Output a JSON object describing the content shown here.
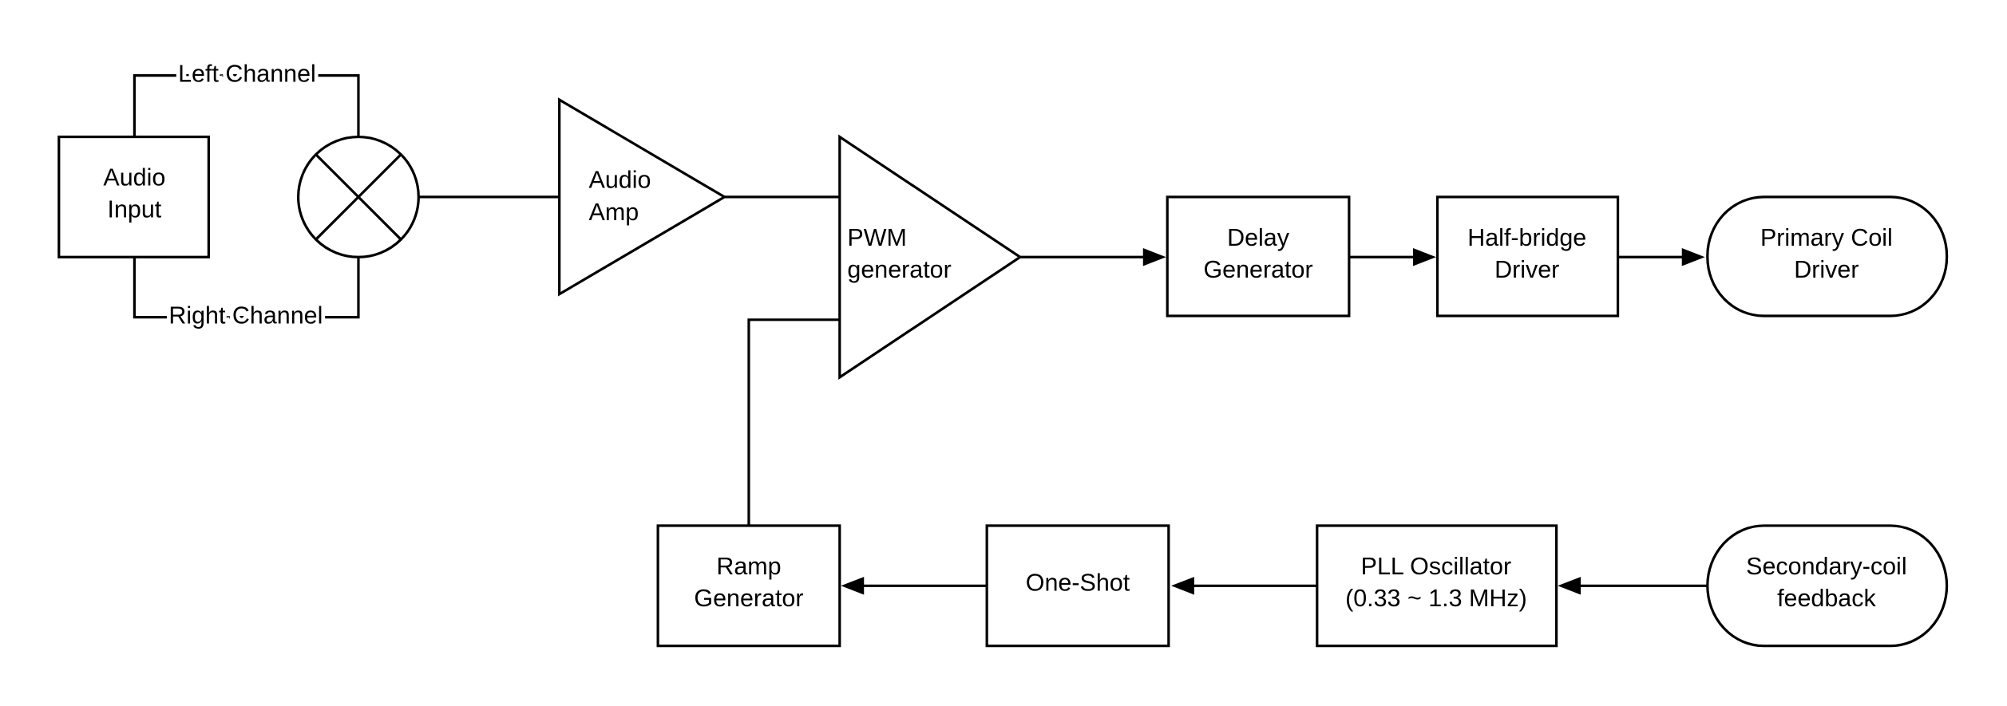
{
  "diagram": {
    "type": "block diagram",
    "nodes": {
      "audio_input": [
        "Audio",
        "Input"
      ],
      "mixer": "",
      "audio_amp": [
        "Audio",
        "Amp"
      ],
      "pwm_generator": [
        "PWM",
        "generator"
      ],
      "delay_generator": [
        "Delay",
        "Generator"
      ],
      "half_bridge_driver": [
        "Half-bridge",
        "Driver"
      ],
      "primary_coil_driver": [
        "Primary Coil",
        "Driver"
      ],
      "ramp_generator": [
        "Ramp",
        "Generator"
      ],
      "one_shot": [
        "One-Shot"
      ],
      "pll_oscillator": [
        "PLL Oscillator",
        "(0.33 ~ 1.3 MHz)"
      ],
      "secondary_coil_feedback": [
        "Secondary-coil",
        "feedback"
      ]
    },
    "edge_labels": {
      "left_channel": "Left Channel",
      "right_channel": "Right Channel"
    },
    "edges": [
      {
        "from": "Audio Input",
        "to": "Mixer",
        "label": "Left Channel"
      },
      {
        "from": "Audio Input",
        "to": "Mixer",
        "label": "Right Channel"
      },
      {
        "from": "Mixer",
        "to": "Audio Amp"
      },
      {
        "from": "Audio Amp",
        "to": "PWM generator"
      },
      {
        "from": "PWM generator",
        "to": "Delay Generator"
      },
      {
        "from": "Delay Generator",
        "to": "Half-bridge Driver"
      },
      {
        "from": "Half-bridge Driver",
        "to": "Primary Coil Driver"
      },
      {
        "from": "Secondary-coil feedback",
        "to": "PLL Oscillator"
      },
      {
        "from": "PLL Oscillator",
        "to": "One-Shot"
      },
      {
        "from": "One-Shot",
        "to": "Ramp Generator"
      },
      {
        "from": "Ramp Generator",
        "to": "PWM generator"
      }
    ]
  }
}
